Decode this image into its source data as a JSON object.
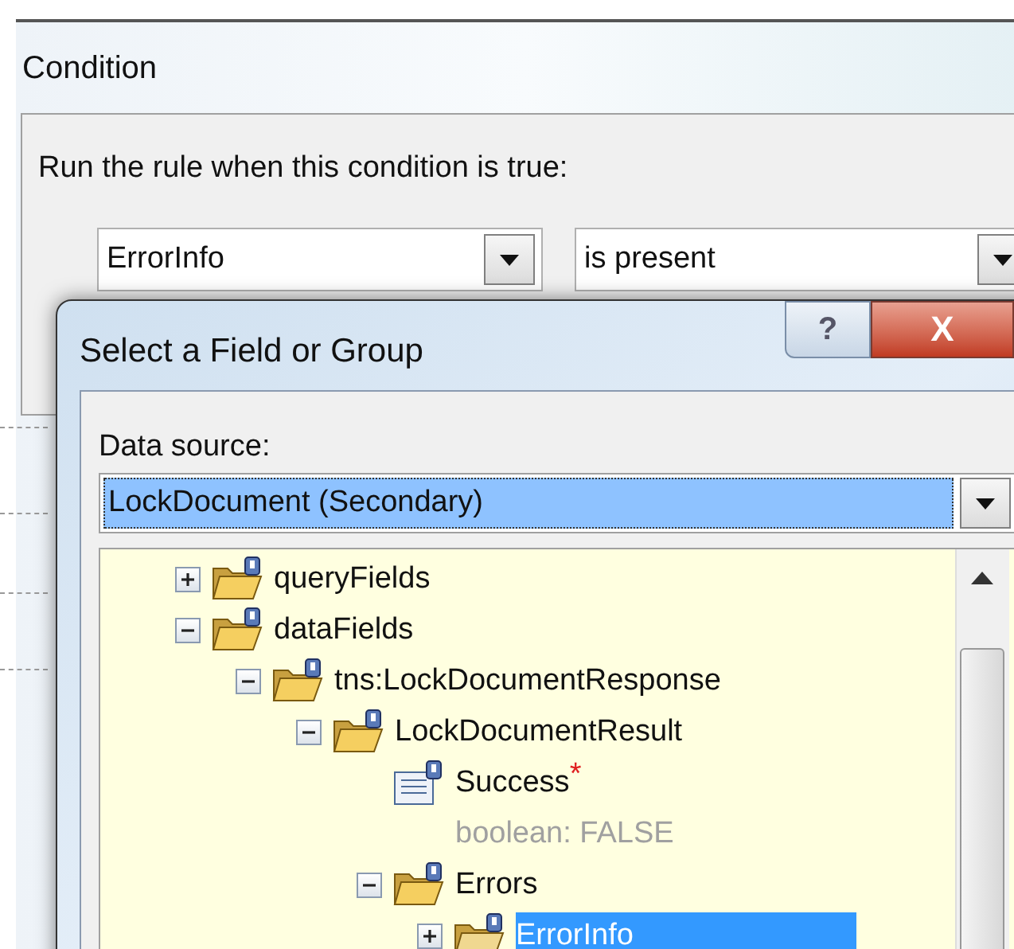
{
  "window": {
    "title": "Condition"
  },
  "condition": {
    "label": "Run the rule when this condition is true:",
    "field": "ErrorInfo",
    "operator": "is present"
  },
  "dialog": {
    "title": "Select a Field or Group",
    "help_button": "?",
    "close_button": "X",
    "data_source": {
      "label": "Data source:",
      "value": "LockDocument (Secondary)"
    },
    "tree": [
      {
        "label": "queryFields",
        "kind": "group",
        "expanded": false,
        "selected": false
      },
      {
        "label": "dataFields",
        "kind": "group",
        "expanded": true,
        "selected": false,
        "children": [
          {
            "label": "tns:LockDocumentResponse",
            "kind": "group",
            "expanded": true,
            "selected": false,
            "children": [
              {
                "label": "LockDocumentResult",
                "kind": "group",
                "expanded": true,
                "selected": false,
                "children": [
                  {
                    "label": "Success",
                    "kind": "field",
                    "required": true,
                    "required_mark": "*",
                    "detail": "boolean: FALSE",
                    "selected": false
                  },
                  {
                    "label": "Errors",
                    "kind": "group",
                    "expanded": true,
                    "selected": false,
                    "children": [
                      {
                        "label": "ErrorInfo",
                        "kind": "group",
                        "expanded": false,
                        "selected": true
                      }
                    ]
                  }
                ]
              }
            ]
          }
        ]
      }
    ]
  }
}
